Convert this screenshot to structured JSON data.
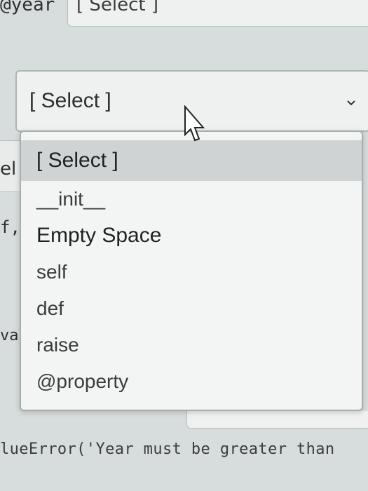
{
  "code": {
    "year_decorator": "@year",
    "line_el": "el",
    "line_f": "f,",
    "line_val": "val",
    "error_line": "lueError('Year must be greater than"
  },
  "top_select": {
    "value": "[ Select ]"
  },
  "main_select": {
    "value": "[ Select ]"
  },
  "dropdown": {
    "options": [
      "[ Select ]",
      "__init__",
      "Empty Space",
      "self",
      "def",
      "raise",
      "@property"
    ]
  }
}
